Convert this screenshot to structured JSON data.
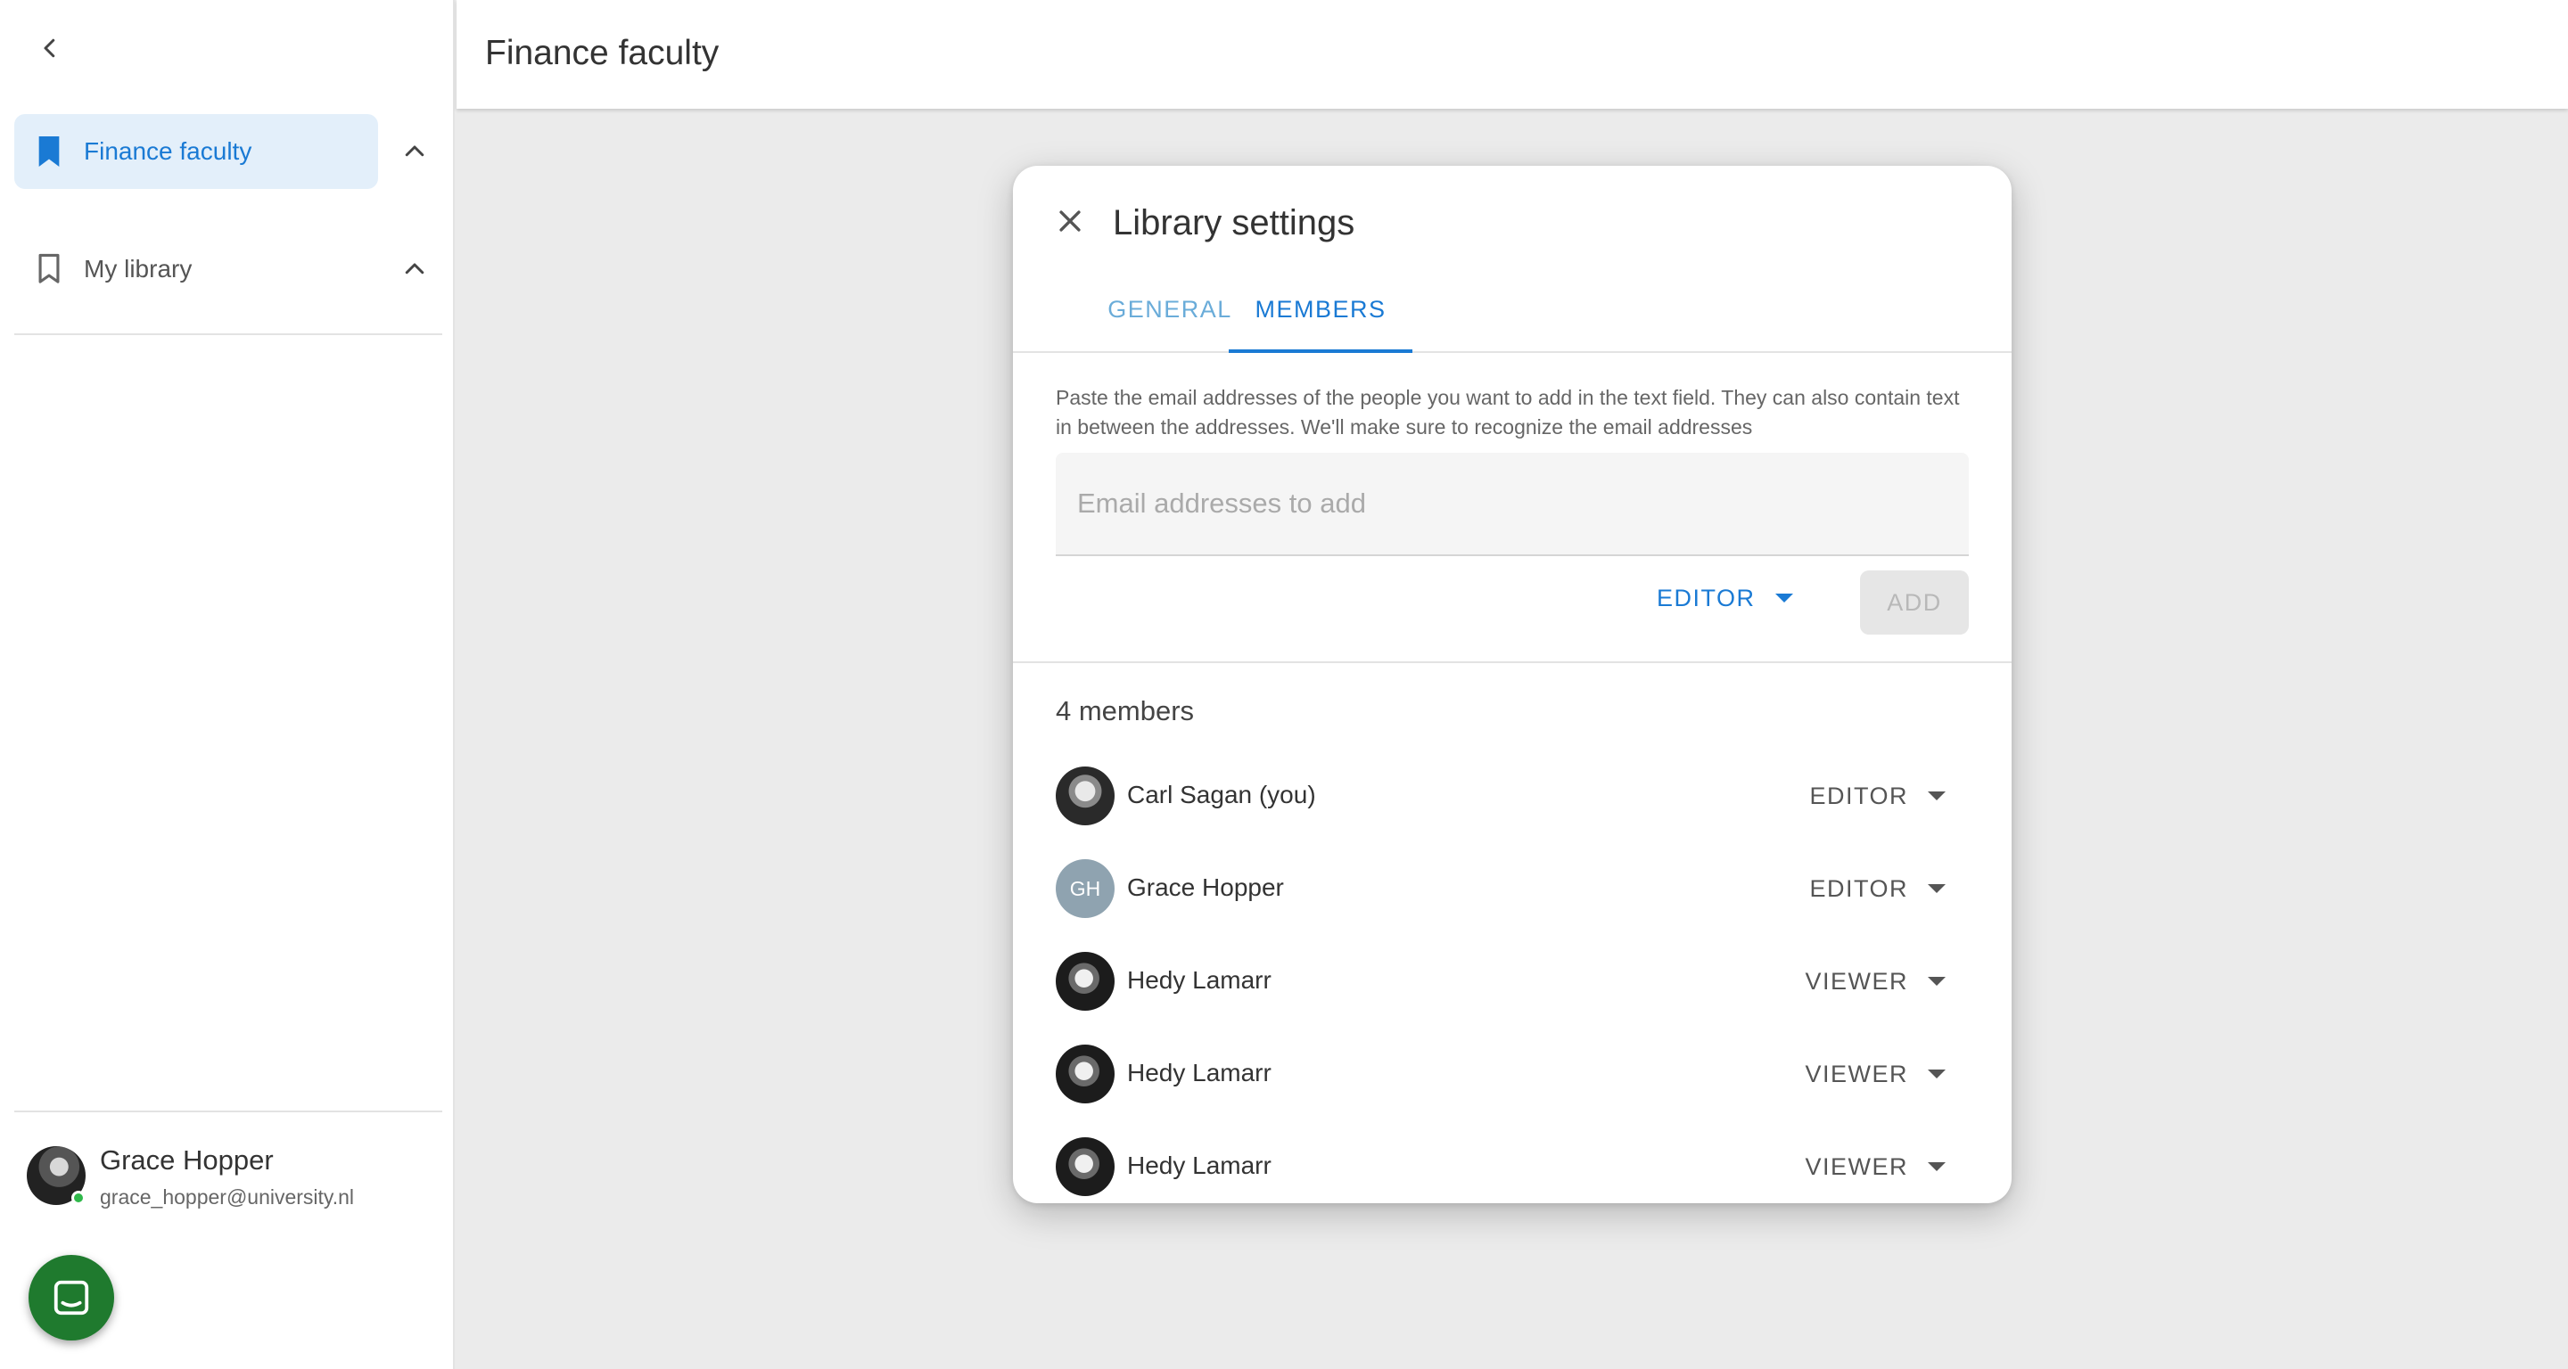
{
  "sidebar": {
    "back_icon": "chevron-left-icon",
    "items": [
      {
        "label": "Finance faculty",
        "icon": "bookmark-filled-icon",
        "active": true
      },
      {
        "label": "My library",
        "icon": "bookmark-outline-icon",
        "active": false
      }
    ],
    "user": {
      "name": "Grace Hopper",
      "email": "grace_hopper@university.nl",
      "status": "online"
    },
    "chat_icon": "chat-icon"
  },
  "header": {
    "title": "Finance faculty"
  },
  "dialog": {
    "title": "Library settings",
    "close_icon": "close-icon",
    "tabs": [
      {
        "label": "GENERAL",
        "active": false
      },
      {
        "label": "MEMBERS",
        "active": true
      }
    ],
    "instructions": "Paste the email addresses of the people you want to add in the text field. They can also contain text in between the addresses. We'll make sure to recognize the email addresses",
    "email_input": {
      "placeholder": "Email addresses to add",
      "value": ""
    },
    "role_select": "EDITOR",
    "add_label": "ADD",
    "members_count": "4 members",
    "members": [
      {
        "name": "Carl Sagan (you)",
        "role": "EDITOR",
        "avatar": "photo"
      },
      {
        "name": "Grace Hopper",
        "role": "EDITOR",
        "avatar": "initials",
        "initials": "GH"
      },
      {
        "name": "Hedy Lamarr",
        "role": "VIEWER",
        "avatar": "photo"
      },
      {
        "name": "Hedy Lamarr",
        "role": "VIEWER",
        "avatar": "photo"
      },
      {
        "name": "Hedy Lamarr",
        "role": "VIEWER",
        "avatar": "photo"
      }
    ]
  },
  "colors": {
    "accent": "#1a7ad4",
    "active_bg": "#e3effa",
    "chat_fab": "#1f7a2e",
    "online": "#2fb84a"
  }
}
